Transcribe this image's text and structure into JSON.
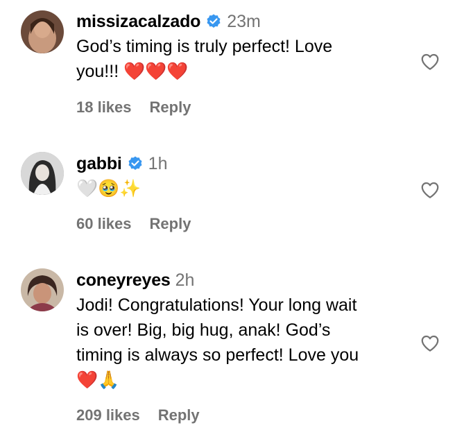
{
  "comments": [
    {
      "username": "missizacalzado",
      "verified": true,
      "time": "23m",
      "text": "God’s timing is truly perfect! Love\nyou!!! ❤️❤️❤️",
      "likes": "18 likes",
      "reply": "Reply",
      "avatar_icon": "avatar-photo"
    },
    {
      "username": "gabbi",
      "verified": true,
      "time": "1h",
      "text": "🤍🥹✨",
      "likes": "60 likes",
      "reply": "Reply",
      "avatar_icon": "avatar-photo"
    },
    {
      "username": "coneyreyes",
      "verified": false,
      "time": "2h",
      "text": "Jodi! Congratulations! Your long wait\nis over! Big, big hug, anak! God’s\ntiming is always so perfect! Love you\n❤️🙏",
      "likes": "209 likes",
      "reply": "Reply",
      "avatar_icon": "avatar-photo"
    }
  ],
  "colors": {
    "secondary_text": "#737373",
    "verified_badge": "#3897f0",
    "heart_outline": "#737373"
  },
  "icons": {
    "verified": "verified-badge-icon",
    "like": "heart-outline-icon"
  }
}
